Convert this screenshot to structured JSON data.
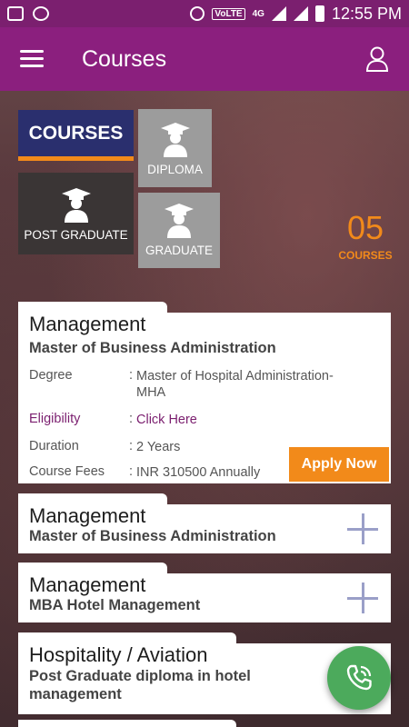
{
  "status_bar": {
    "time": "12:55 PM",
    "network_badge": "VoLTE",
    "network_type": "4G"
  },
  "app_bar": {
    "title": "Courses"
  },
  "tiles": {
    "courses": "COURSES",
    "diploma": "DIPLOMA",
    "post_graduate": "POST GRADUATE",
    "graduate": "GRADUATE"
  },
  "course_count": {
    "number": "05",
    "label": "COURSES"
  },
  "cards": [
    {
      "category": "Management",
      "name": "Master of Business Administration",
      "expanded": true,
      "details": {
        "degree_label": "Degree",
        "degree": "Master of Hospital Administration-MHA",
        "eligibility_label": "Eligibility",
        "eligibility": "Click Here",
        "duration_label": "Duration",
        "duration": "2 Years",
        "fees_label": "Course Fees",
        "fees": "INR 310500 Annually"
      },
      "apply_label": "Apply Now"
    },
    {
      "category": "Management",
      "name": "Master of Business Administration",
      "expanded": false
    },
    {
      "category": "Management",
      "name": "MBA Hotel Management",
      "expanded": false
    },
    {
      "category": "Hospitality / Aviation",
      "name": "Post Graduate diploma in hotel management",
      "expanded": false
    }
  ],
  "colors": {
    "app_bar": "#8b1f7e",
    "accent": "#f28a1a",
    "courses_tile": "#2a2f6e",
    "fab": "#4caa5c",
    "link": "#7b1f6f"
  },
  "icons": [
    "menu-icon",
    "user-icon",
    "graduate-icon",
    "plus-icon",
    "phone-icon"
  ]
}
